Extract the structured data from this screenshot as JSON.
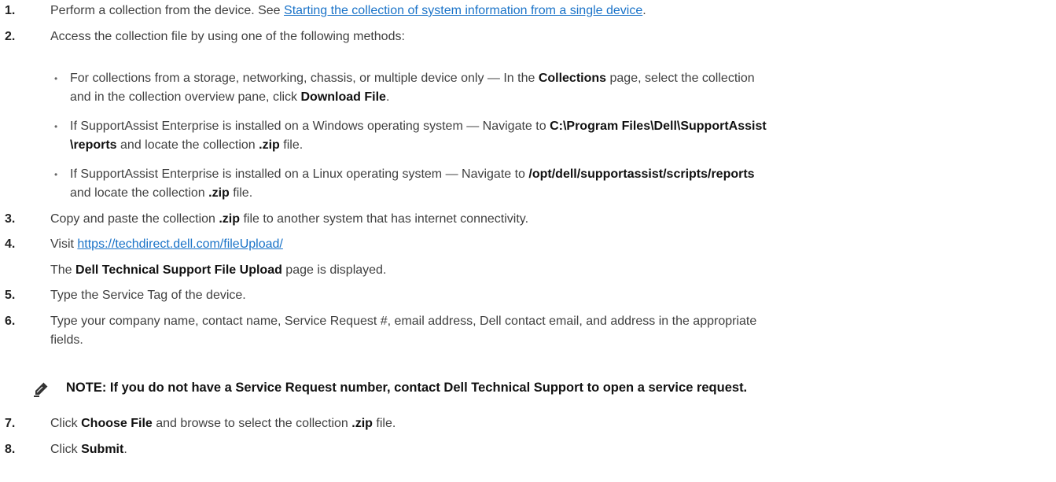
{
  "steps": [
    {
      "num": "1.",
      "t1": "Perform a collection from the device. See ",
      "link": "Starting the collection of system information from a single device",
      "t2": "."
    },
    {
      "num": "2.",
      "text": "Access the collection file by using one of the following methods:"
    },
    {
      "num": "3.",
      "t1": "Copy and paste the collection ",
      "b1": ".zip",
      "t2": " file to another system that has internet connectivity."
    },
    {
      "num": "4.",
      "t1": "Visit ",
      "link": "https://techdirect.dell.com/fileUpload/"
    },
    {
      "num": "5.",
      "text": "Type the Service Tag of the device."
    },
    {
      "num": "6.",
      "text": "Type your company name, contact name, Service Request #, email address, Dell contact email, and address in the appropriate",
      "text2": "fields."
    },
    {
      "num": "7.",
      "t1": "Click ",
      "b1": "Choose File",
      "t2": " and browse to select the collection ",
      "b2": ".zip",
      "t3": " file."
    },
    {
      "num": "8.",
      "t1": "Click ",
      "b1": "Submit",
      "t2": "."
    }
  ],
  "methods": [
    {
      "l1a": "For collections from a storage, networking, chassis, or multiple device only — In the ",
      "l1b": "Collections",
      "l1c": " page, select the collection",
      "l2a": "and in the collection overview pane, click ",
      "l2b": "Download File",
      "l2c": "."
    },
    {
      "l1a": "If SupportAssist Enterprise is installed on a Windows operating system — Navigate to ",
      "l1b": "C:\\Program Files\\Dell\\SupportAssist",
      "l2a": "\\reports",
      "l2b": " and locate the collection ",
      "l2c": ".zip",
      "l2d": " file."
    },
    {
      "l1a": "If SupportAssist Enterprise is installed on a Linux operating system — Navigate to ",
      "l1b": "/opt/dell/supportassist/scripts/reports",
      "l2a": "and locate the collection ",
      "l2b": ".zip",
      "l2c": " file."
    }
  ],
  "step4_result": {
    "a": "The ",
    "b": "Dell Technical Support File Upload",
    "c": " page is displayed."
  },
  "note": {
    "icon": "note-pencil-icon",
    "text": "NOTE: If you do not have a Service Request number, contact Dell Technical Support to open a service request."
  }
}
